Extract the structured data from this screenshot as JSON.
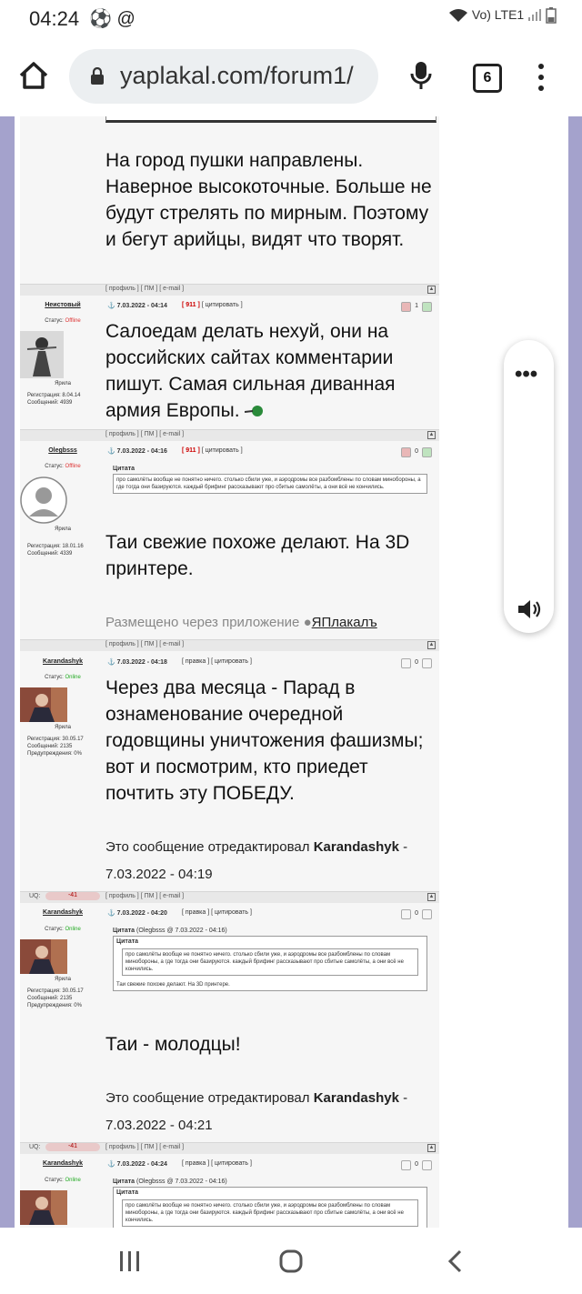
{
  "status_bar": {
    "time": "04:24",
    "notif_icons": "⚽ @",
    "signal": "Vo) LTE1"
  },
  "browser": {
    "url": "yaplakal.com/forum1/",
    "tab_count": "6"
  },
  "posts": [
    {
      "text": "На город пушки направлены. Наверное высокоточные. Больше не будут стрелять по мирным. Поэтому и бегут арийцы, видят что творят.",
      "bar_links": "[ профиль ] [ ПМ ] [ e-mail ]"
    },
    {
      "nick": "Неистовый",
      "date": "7.03.2022 - 04:14",
      "links_red": "[ 911 ]",
      "links": "[ цитировать ]",
      "status_label": "Статус:",
      "status": "Offline",
      "rank": "Ярила",
      "meta": [
        "Регистрация: 8.04.14",
        "Сообщений: 4939"
      ],
      "votes": "1",
      "text": "Салоедам делать нехуй, они на российских сайтах комментарии пишут. Самая сильная диванная армия Европы.",
      "bar_links": "[ профиль ] [ ПМ ] [ e-mail ]"
    },
    {
      "nick": "Olegbsss",
      "date": "7.03.2022 - 04:16",
      "links_red": "[ 911 ]",
      "links": "[ цитировать ]",
      "status_label": "Статус:",
      "status": "Offline",
      "rank": "Ярила",
      "meta": [
        "Регистрация: 18.01.16",
        "Сообщений: 4339"
      ],
      "votes": "0",
      "quote_title": "Цитата",
      "quote": "про самолёты вообще не понятно ничего. столько сбили уже, и аэродромы все разбомблены по словам минобороны, а где тогда они базируются. каждый брифинг рассказывают про сбитые самолёты, а они всё не кончились.",
      "text": "Таи свежие похоже делают. На 3D принтере.",
      "via_label": "Размещено через приложение",
      "via_app": "ЯПлакалъ",
      "bar_links": "[ профиль ] [ ПМ ] [ e-mail ]"
    },
    {
      "nick": "Karandashyk",
      "date": "7.03.2022 - 04:18",
      "links": "[ правка ] [ цитировать ]",
      "status_label": "Статус:",
      "status": "Online",
      "rank": "Ярила",
      "meta": [
        "Регистрация: 30.05.17",
        "Сообщений: 2135",
        "Предупреждения: 0%"
      ],
      "votes": "0",
      "text": "Через два месяца - Парад в ознаменование очередной годовщины уничтожения фашизмы; вот и посмотрим, кто приедет почтить эту ПОБЕДУ.",
      "edited_prefix": "Это сообщение отредактировал",
      "edited_by": "Karandashyk",
      "edited_time": "- 7.03.2022 - 04:19",
      "uq_label": "UQ:",
      "uq_value": "-41",
      "bar_links": "[ профиль ] [ ПМ ] [ e-mail ]"
    },
    {
      "nick": "Karandashyk",
      "date": "7.03.2022 - 04:20",
      "links": "[ правка ] [ цитировать ]",
      "status_label": "Статус:",
      "status": "Online",
      "rank": "Ярила",
      "meta": [
        "Регистрация: 30.05.17",
        "Сообщений: 2135",
        "Предупреждения: 0%"
      ],
      "votes": "0",
      "quote_title": "Цитата",
      "quote_source": "(Olegbsss @ 7.03.2022 - 04:16)",
      "quote_inner_title": "Цитата",
      "quote_inner": "про самолёты вообще не понятно ничего. столько сбили уже, и аэродромы все разбомблены по словам минобороны, а где тогда они базируются. каждый брифинг рассказывают про сбитые самолёты, а они всё не кончились.",
      "quote": "Таи свежие похоже делают. На 3D принтере.",
      "text": "Таи - молодцы!",
      "edited_prefix": "Это сообщение отредактировал",
      "edited_by": "Karandashyk",
      "edited_time": "- 7.03.2022 - 04:21",
      "uq_label": "UQ:",
      "uq_value": "-41",
      "bar_links": "[ профиль ] [ ПМ ] [ e-mail ]"
    },
    {
      "nick": "Karandashyk",
      "date": "7.03.2022 - 04:24",
      "links": "[ правка ] [ цитировать ]",
      "status_label": "Статус:",
      "status": "Online",
      "votes": "0",
      "quote_title": "Цитата",
      "quote_source": "(Olegbsss @ 7.03.2022 - 04:16)",
      "quote_inner_title": "Цитата",
      "quote_inner": "про самолёты вообще не понятно ничего. столько сбили уже, и аэродромы все разбомблены по словам минобороны, а где тогда они базируются. каждый брифинг рассказывают про сбитые самолёты, а они всё не кончились."
    }
  ]
}
